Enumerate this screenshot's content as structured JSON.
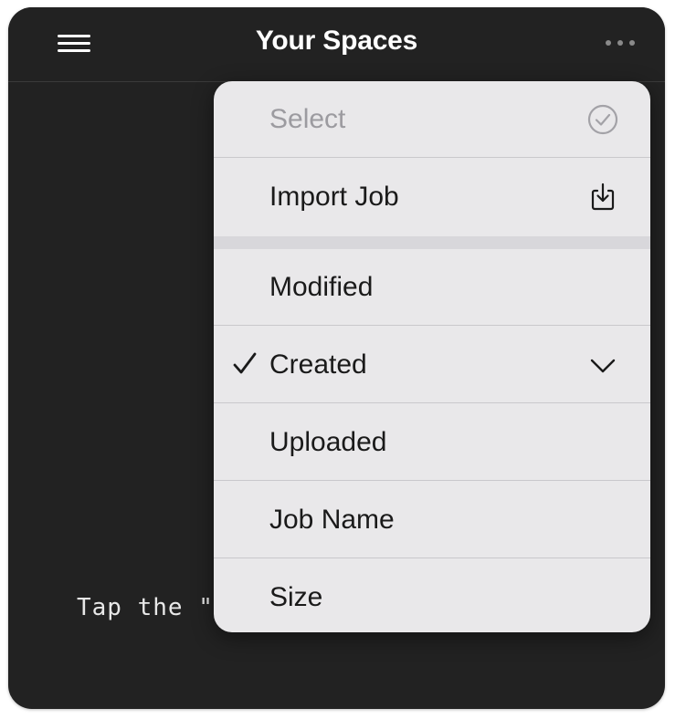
{
  "navbar": {
    "title": "Your Spaces"
  },
  "background_hint": "Tap the \"-",
  "menu": {
    "select_label": "Select",
    "import_label": "Import Job",
    "sort_options": [
      {
        "label": "Modified",
        "checked": false
      },
      {
        "label": "Created",
        "checked": true
      },
      {
        "label": "Uploaded",
        "checked": false
      },
      {
        "label": "Job Name",
        "checked": false
      },
      {
        "label": "Size",
        "checked": false
      }
    ]
  },
  "colors": {
    "background": "#222222",
    "menu_background": "#e9e8ea",
    "disabled_text": "#9c9ba0"
  }
}
